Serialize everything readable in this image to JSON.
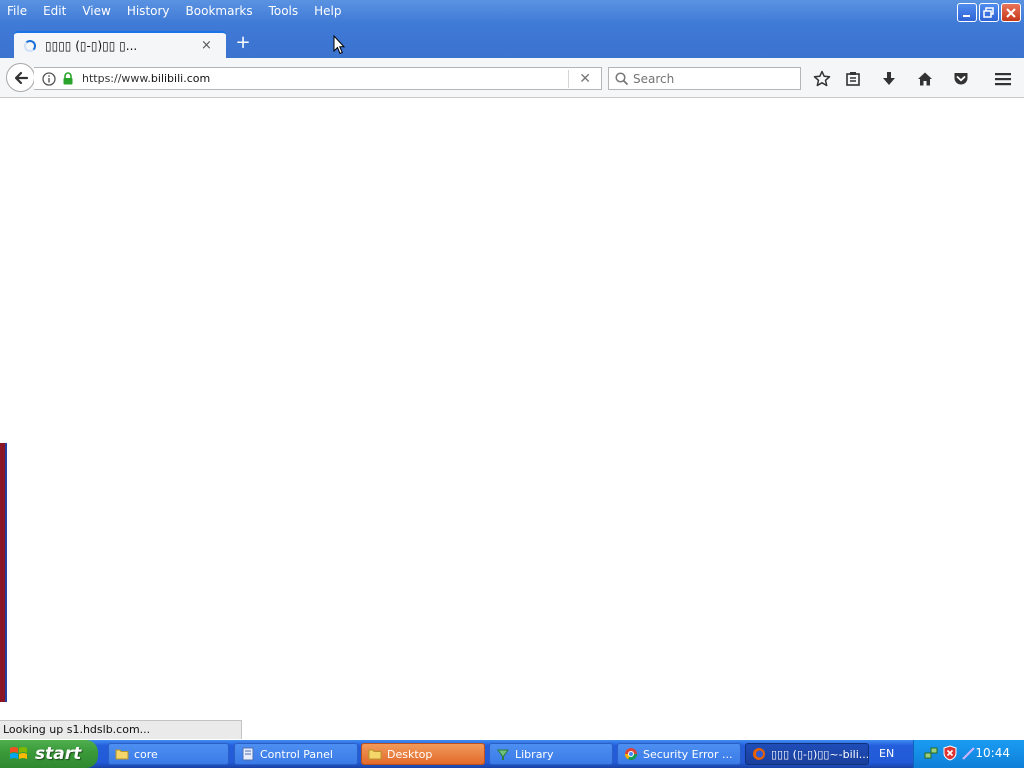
{
  "menubar": {
    "items": [
      "File",
      "Edit",
      "View",
      "History",
      "Bookmarks",
      "Tools",
      "Help"
    ]
  },
  "tab": {
    "title": "▯▯▯▯ (▯-▯)▯▯ ▯...",
    "close_glyph": "×",
    "new_tab_glyph": "+"
  },
  "navbar": {
    "url_prefix": "https://www.",
    "url_domain": "bilibili.com",
    "stop_glyph": "✕",
    "search_placeholder": "Search"
  },
  "status": {
    "text": "Looking up s1.hdslb.com..."
  },
  "taskbar": {
    "start_label": "start",
    "buttons": [
      {
        "label": "core"
      },
      {
        "label": "Control Panel"
      },
      {
        "label": "Desktop"
      },
      {
        "label": "Library"
      },
      {
        "label": "Security Error ..."
      },
      {
        "label": "▯▯▯ (▯-▯)▯▯~-bili..."
      }
    ],
    "language": "EN",
    "clock": "10:44"
  },
  "colors": {
    "titlebar_blue": "#3f7ad6",
    "taskbar_blue": "#245edb",
    "start_green": "#3c9a3b",
    "active_task_orange": "#e26a2c"
  }
}
